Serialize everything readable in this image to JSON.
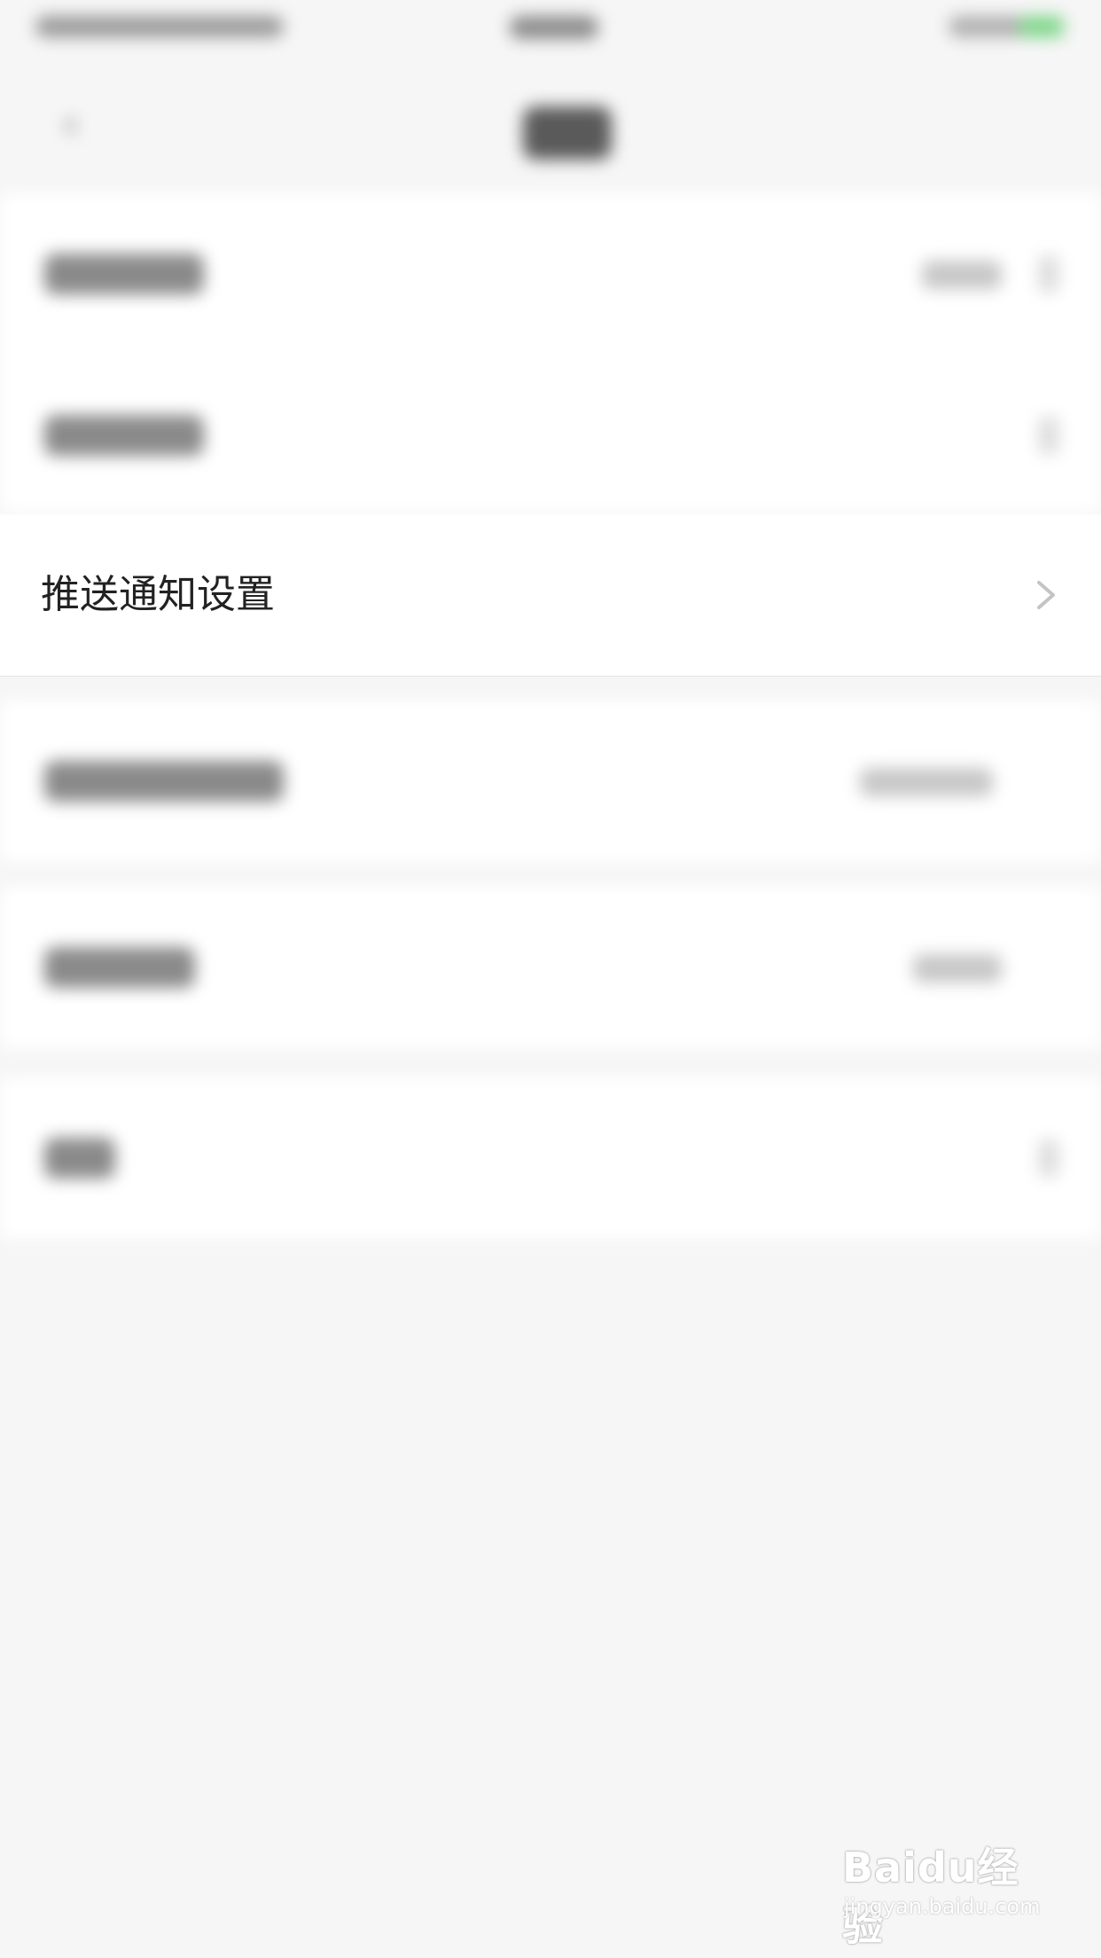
{
  "focus_item": {
    "label": "推送通知设置",
    "icon": "chevron-right-icon"
  },
  "watermark": {
    "logo_text": "Baidu经验",
    "url_text": "jingyan.baidu.com"
  },
  "colors": {
    "background": "#f6f6f6",
    "row_background": "#ffffff",
    "label_text": "#222222",
    "chevron": "#c4c4c4",
    "battery": "#7fd68a"
  }
}
